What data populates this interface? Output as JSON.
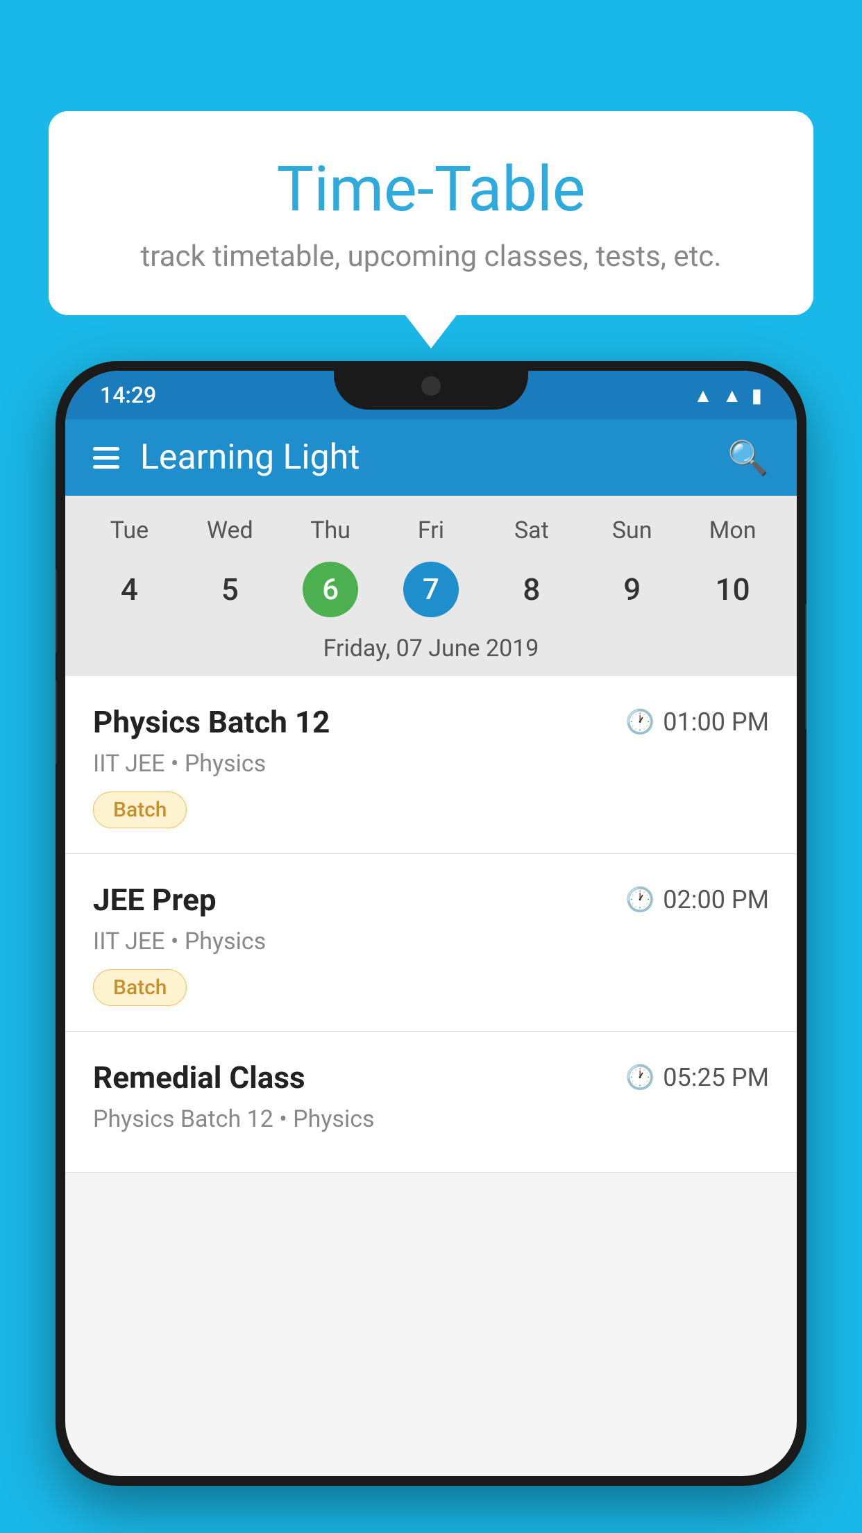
{
  "background_color": "#1ab8e8",
  "bubble": {
    "title": "Time-Table",
    "subtitle": "track timetable, upcoming classes, tests, etc."
  },
  "phone": {
    "status_bar": {
      "time": "14:29",
      "icons": [
        "wifi",
        "signal",
        "battery"
      ]
    },
    "app_bar": {
      "title": "Learning Light"
    },
    "calendar": {
      "days": [
        "Tue",
        "Wed",
        "Thu",
        "Fri",
        "Sat",
        "Sun",
        "Mon"
      ],
      "dates": [
        "4",
        "5",
        "6",
        "7",
        "8",
        "9",
        "10"
      ],
      "today_index": 2,
      "selected_index": 3,
      "selected_label": "Friday, 07 June 2019"
    },
    "schedule": [
      {
        "title": "Physics Batch 12",
        "time": "01:00 PM",
        "sub": "IIT JEE • Physics",
        "badge": "Batch"
      },
      {
        "title": "JEE Prep",
        "time": "02:00 PM",
        "sub": "IIT JEE • Physics",
        "badge": "Batch"
      },
      {
        "title": "Remedial Class",
        "time": "05:25 PM",
        "sub": "Physics Batch 12 • Physics",
        "badge": null
      }
    ]
  }
}
